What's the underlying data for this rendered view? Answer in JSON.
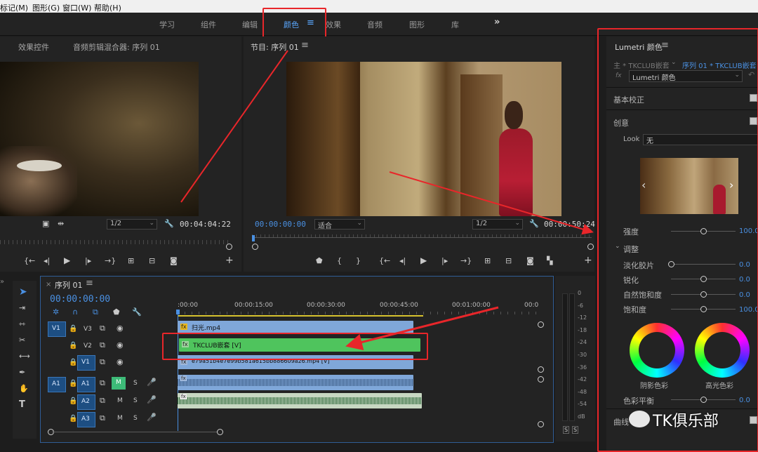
{
  "menu": [
    "标记(M)",
    "图形(G)",
    "窗口(W)",
    "帮助(H)"
  ],
  "workspace_tabs": [
    "学习",
    "组件",
    "编辑",
    "颜色",
    "效果",
    "音频",
    "图形",
    "库"
  ],
  "workspace_active": "颜色",
  "workspace_more": "»",
  "source_panel": {
    "tabs": [
      "效果控件",
      "音频剪辑混合器: 序列 01"
    ],
    "zoom": "1/2",
    "timecode": "00:04:04:22"
  },
  "program_panel": {
    "title": "节目: 序列 01",
    "timecode_in": "00:00:00:00",
    "fit": "适合",
    "zoom": "1/2",
    "timecode_out": "00:00:50:24"
  },
  "timeline": {
    "title": "序列 01",
    "timecode": "00:00:00:00",
    "ruler": [
      ":00:00",
      "00:00:15:00",
      "00:00:30:00",
      "00:00:45:00",
      "00:01:00:00",
      "00:0"
    ],
    "video_tracks": [
      {
        "label": "V3",
        "src": "V1",
        "clip": "扫光.mp4"
      },
      {
        "label": "V2",
        "src": "",
        "clip": "TKCLUB嵌套 [V]"
      },
      {
        "label": "V1",
        "src": "",
        "clip": "e79a51b4e7e99b581a615bb886609a26.mp4 [V]"
      }
    ],
    "audio_tracks": [
      {
        "label": "A1",
        "src": "A1",
        "m": "M",
        "s": "S"
      },
      {
        "label": "A2",
        "src": "",
        "m": "M",
        "s": "S"
      },
      {
        "label": "A3",
        "src": "",
        "m": "M",
        "s": "S"
      }
    ]
  },
  "meter": {
    "scale": [
      "0",
      "-6",
      "-12",
      "-18",
      "-24",
      "-30",
      "-36",
      "-42",
      "-48",
      "-54",
      "dB"
    ],
    "solo": [
      "S",
      "S"
    ]
  },
  "lumetri": {
    "title": "Lumetri 颜色",
    "master": "主 * TKCLUB嵌套",
    "sequence": "序列 01 * TKCLUB嵌套",
    "fx_label": "fx",
    "effect": "Lumetri 颜色",
    "basic": "基本校正",
    "creative": "创意",
    "look_label": "Look",
    "look_value": "无",
    "intensity_label": "强度",
    "intensity": "100.0",
    "adjust": "调整",
    "sliders": [
      {
        "label": "淡化胶片",
        "value": "0.0",
        "pos": 0.0
      },
      {
        "label": "锐化",
        "value": "0.0",
        "pos": 0.5
      },
      {
        "label": "自然饱和度",
        "value": "0.0",
        "pos": 0.5
      },
      {
        "label": "饱和度",
        "value": "100.0",
        "pos": 0.5
      }
    ],
    "shadow_tint": "阴影色彩",
    "highlight_tint": "高光色彩",
    "color_balance_label": "色彩平衡",
    "color_balance": "0.0",
    "curves": "曲线"
  },
  "watermark": "TK俱乐部"
}
